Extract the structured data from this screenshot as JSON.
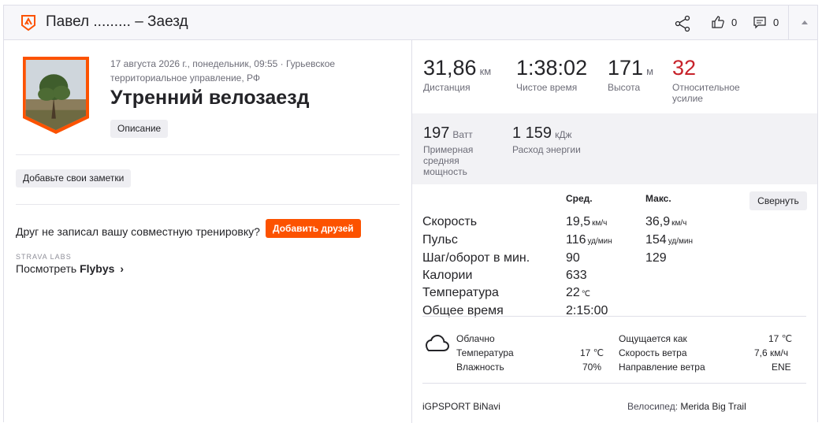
{
  "header": {
    "title": "Павел ......... – Заезд",
    "kudos_count": "0",
    "comments_count": "0"
  },
  "activity": {
    "meta": "17 августа 2026 г., понедельник, 09:55 · Гурьевское территориальное управление, РФ",
    "title": "Утренний велозаезд",
    "description_button": "Описание",
    "notes_button": "Добавьте свои заметки",
    "friend_prompt": "Друг не записал вашу совместную тренировку?",
    "add_friends_button": "Добавить друзей",
    "labs_label": "STRAVA LABS",
    "flybys_prefix": "Посмотреть",
    "flybys_link": "Flybys",
    "flybys_chevron": "›"
  },
  "stats": {
    "distance": {
      "value": "31,86",
      "unit": "км",
      "label": "Дистанция"
    },
    "moving_time": {
      "value": "1:38:02",
      "label": "Чистое время"
    },
    "elevation": {
      "value": "171",
      "unit": "м",
      "label": "Высота"
    },
    "relative_effort": {
      "value": "32",
      "label": "Относительное усилие",
      "color": "#c7222a"
    },
    "power": {
      "value": "197",
      "unit": "Ватт",
      "label": "Примерная средняя мощность"
    },
    "energy": {
      "value": "1 159",
      "unit": "кДж",
      "label": "Расход энергии"
    }
  },
  "more": {
    "avg_header": "Сред.",
    "max_header": "Макс.",
    "collapse_button": "Свернуть",
    "rows": [
      {
        "label": "Скорость",
        "avg": "19,5",
        "avg_unit": "км/ч",
        "max": "36,9",
        "max_unit": "км/ч"
      },
      {
        "label": "Пульс",
        "avg": "116",
        "avg_unit": "уд/мин",
        "max": "154",
        "max_unit": "уд/мин"
      },
      {
        "label": "Шаг/оборот в мин.",
        "avg": "90",
        "avg_unit": "",
        "max": "129",
        "max_unit": ""
      },
      {
        "label": "Калории",
        "avg": "633",
        "avg_unit": "",
        "max": "",
        "max_unit": ""
      },
      {
        "label": "Температура",
        "avg": "22",
        "avg_unit": "℃",
        "max": "",
        "max_unit": ""
      },
      {
        "label": "Общее время",
        "avg": "2:15:00",
        "avg_unit": "",
        "max": "",
        "max_unit": ""
      }
    ]
  },
  "weather": {
    "condition": "Облачно",
    "temp_label": "Температура",
    "temp_value": "17 ℃",
    "humidity_label": "Влажность",
    "humidity_value": "70%",
    "feels_label": "Ощущается как",
    "feels_value": "17 ℃",
    "wind_speed_label": "Скорость ветра",
    "wind_speed_value": "7,6 км/ч",
    "wind_dir_label": "Направление ветра",
    "wind_dir_value": "ENE",
    "icon": "cloud-icon"
  },
  "device": {
    "name": "iGPSPORT BiNavi",
    "bike_label": "Велосипед:",
    "bike_name": "Merida Big Trail"
  },
  "colors": {
    "brand": "#fc5200",
    "effort": "#c7222a"
  }
}
